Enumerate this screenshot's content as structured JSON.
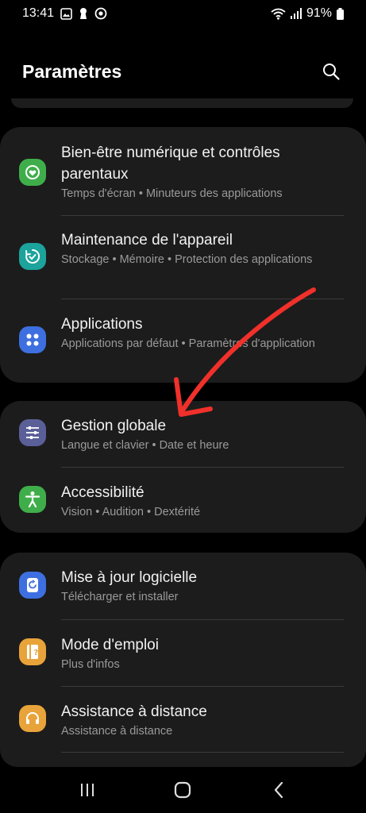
{
  "status_bar": {
    "time": "13:41",
    "battery": "91%"
  },
  "header": {
    "title": "Paramètres"
  },
  "groups": [
    {
      "items": [
        {
          "title": "Bien-être numérique et contrôles parentaux",
          "subtitle": "Temps d'écran  •  Minuteurs des applications",
          "icon": "digital-wellbeing-icon",
          "color": "#3fae4a"
        },
        {
          "title": "Maintenance de l'appareil",
          "subtitle": "Stockage  •  Mémoire  •  Protection des applications",
          "icon": "device-care-icon",
          "color": "#1ba39c"
        },
        {
          "title": "Applications",
          "subtitle": "Applications par défaut  •  Paramètres d'application",
          "icon": "apps-icon",
          "color": "#3d6fe0"
        }
      ]
    },
    {
      "items": [
        {
          "title": "Gestion globale",
          "subtitle": "Langue et clavier  •  Date et heure",
          "icon": "sliders-icon",
          "color": "#5b5f98"
        },
        {
          "title": "Accessibilité",
          "subtitle": "Vision  •  Audition  •  Dextérité",
          "icon": "accessibility-icon",
          "color": "#3fae4a"
        }
      ]
    },
    {
      "items": [
        {
          "title": "Mise à jour logicielle",
          "subtitle": "Télécharger et installer",
          "icon": "software-update-icon",
          "color": "#3d6fe0"
        },
        {
          "title": "Mode d'emploi",
          "subtitle": "Plus d'infos",
          "icon": "user-manual-icon",
          "color": "#e8a33a"
        },
        {
          "title": "Assistance à distance",
          "subtitle": "Assistance à distance",
          "icon": "headset-icon",
          "color": "#e8a33a"
        }
      ]
    }
  ],
  "annotation": {
    "color": "#f0302a"
  }
}
